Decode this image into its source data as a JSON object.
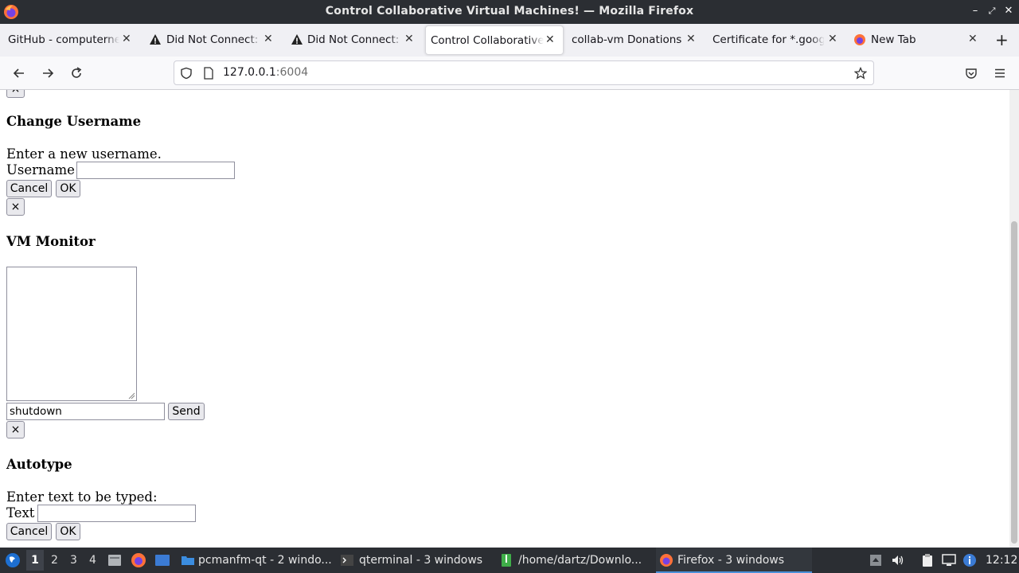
{
  "window": {
    "title": "Control Collaborative Virtual Machines! — Mozilla Firefox",
    "controls": {
      "minimize": "–",
      "maximize": "✕",
      "close": "✕"
    }
  },
  "tabs": [
    {
      "label": "GitHub - computerne",
      "icon": "none",
      "active": false
    },
    {
      "label": "Did Not Connect:",
      "icon": "warning-icon",
      "active": false
    },
    {
      "label": "Did Not Connect:",
      "icon": "warning-icon",
      "active": false
    },
    {
      "label": "Control Collaborative",
      "icon": "none",
      "active": true
    },
    {
      "label": "collab-vm Donations",
      "icon": "none",
      "active": false
    },
    {
      "label": "Certificate for *.goog",
      "icon": "none",
      "active": false
    },
    {
      "label": "New Tab",
      "icon": "firefox-icon",
      "active": false
    }
  ],
  "nav": {
    "url_host": "127.0.0.1",
    "url_port": ":6004"
  },
  "page": {
    "change_username": {
      "heading": "Change Username",
      "prompt": "Enter a new username.",
      "field_label": "Username",
      "field_value": "",
      "cancel": "Cancel",
      "ok": "OK",
      "close": "×"
    },
    "vm_monitor": {
      "heading": "VM Monitor",
      "command_value": "shutdown",
      "send": "Send",
      "close": "×"
    },
    "autotype": {
      "heading": "Autotype",
      "prompt": "Enter text to be typed:",
      "field_label": "Text",
      "field_value": "",
      "cancel": "Cancel",
      "ok": "OK"
    }
  },
  "taskbar": {
    "workspaces": [
      "1",
      "2",
      "3",
      "4"
    ],
    "tasks": [
      {
        "label": "pcmanfm-qt - 2 windo..."
      },
      {
        "label": "qterminal - 3 windows"
      },
      {
        "label": "/home/dartz/Downlo..."
      },
      {
        "label": "Firefox - 3 windows"
      }
    ],
    "clock": "12:12"
  }
}
